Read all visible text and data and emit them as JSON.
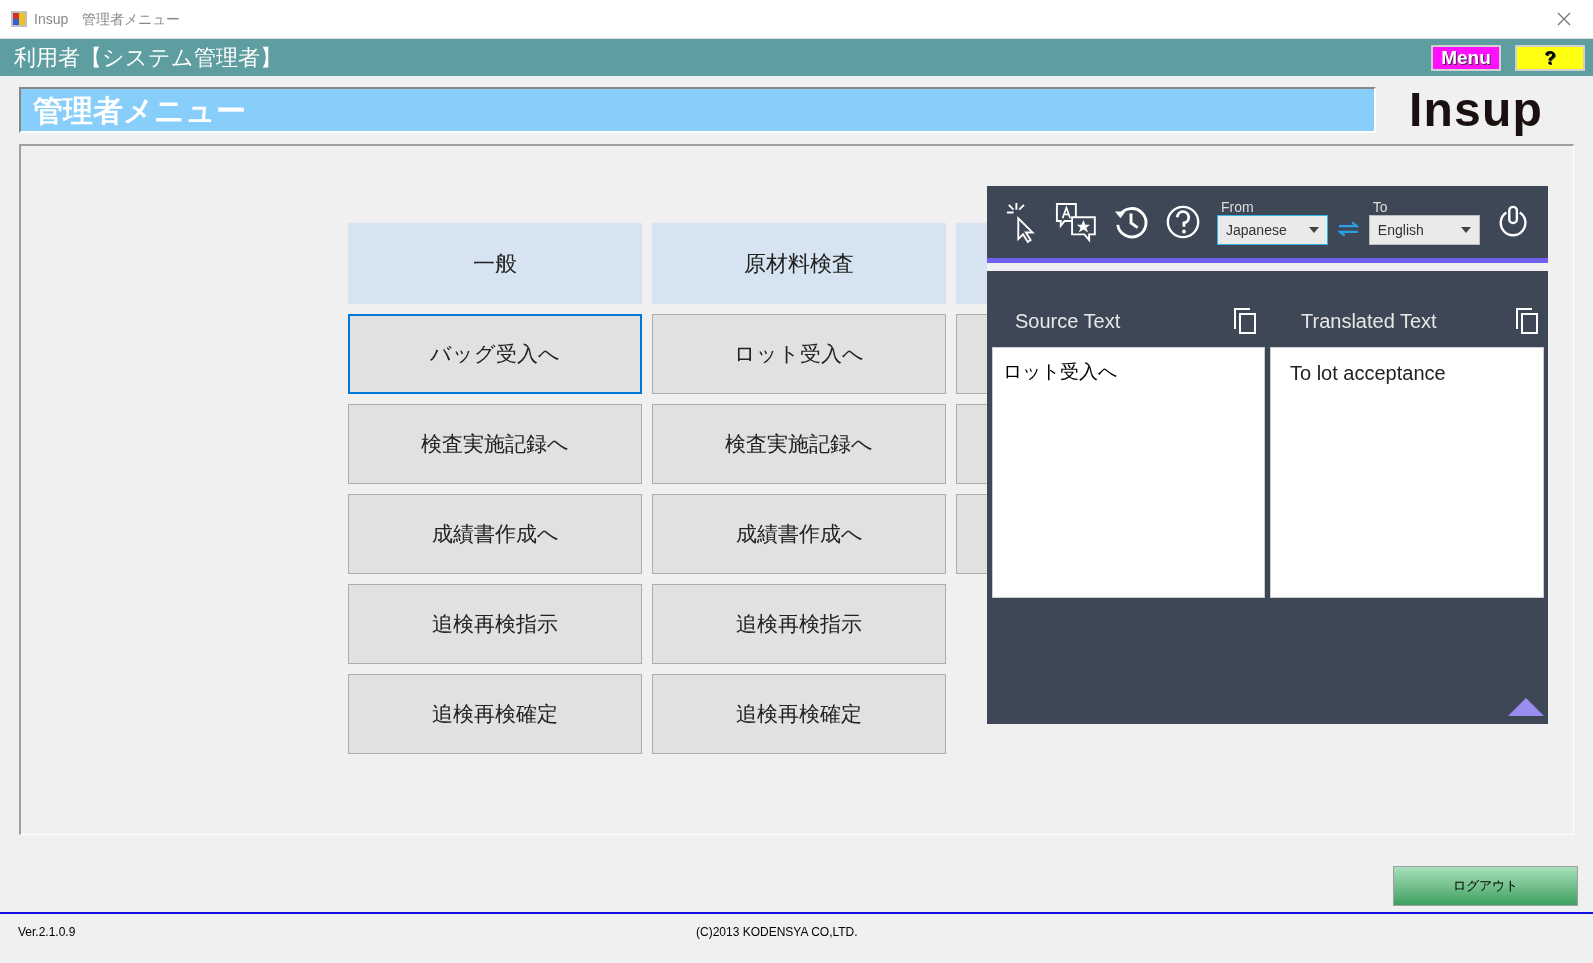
{
  "window": {
    "title": "Insup　管理者メニュー"
  },
  "user_bar": {
    "user": "利用者【システム管理者】",
    "buttons": [
      {
        "kind": "menu",
        "label": "Menu"
      },
      {
        "kind": "help",
        "label": "?"
      }
    ]
  },
  "heading": {
    "title": "管理者メニュー",
    "logo": "Insup"
  },
  "menu_columns": [
    {
      "header": "一般",
      "items": [
        {
          "label": "バッグ受入へ",
          "selected": true
        },
        {
          "label": "検査実施記録へ",
          "selected": false
        },
        {
          "label": "成績書作成へ",
          "selected": false
        },
        {
          "label": "追検再検指示",
          "selected": false
        },
        {
          "label": "追検再検確定",
          "selected": false
        }
      ]
    },
    {
      "header": "原材料検査",
      "items": [
        {
          "label": "ロット受入へ",
          "selected": false
        },
        {
          "label": "検査実施記録へ",
          "selected": false
        },
        {
          "label": "成績書作成へ",
          "selected": false
        },
        {
          "label": "追検再検指示",
          "selected": false
        },
        {
          "label": "追検再検確定",
          "selected": false
        }
      ]
    }
  ],
  "translator": {
    "from_label": "From",
    "from_value": "Japanese",
    "to_label": "To",
    "to_value": "English",
    "source_title": "Source Text",
    "translated_title": "Translated Text",
    "source_text": "ロット受入へ",
    "translated_text": "To lot acceptance"
  },
  "logout_button": "ログアウト",
  "status_bar": {
    "version": "Ver.2.1.0.9",
    "copyright": "(C)2013 KODENSYA CO,LTD."
  }
}
